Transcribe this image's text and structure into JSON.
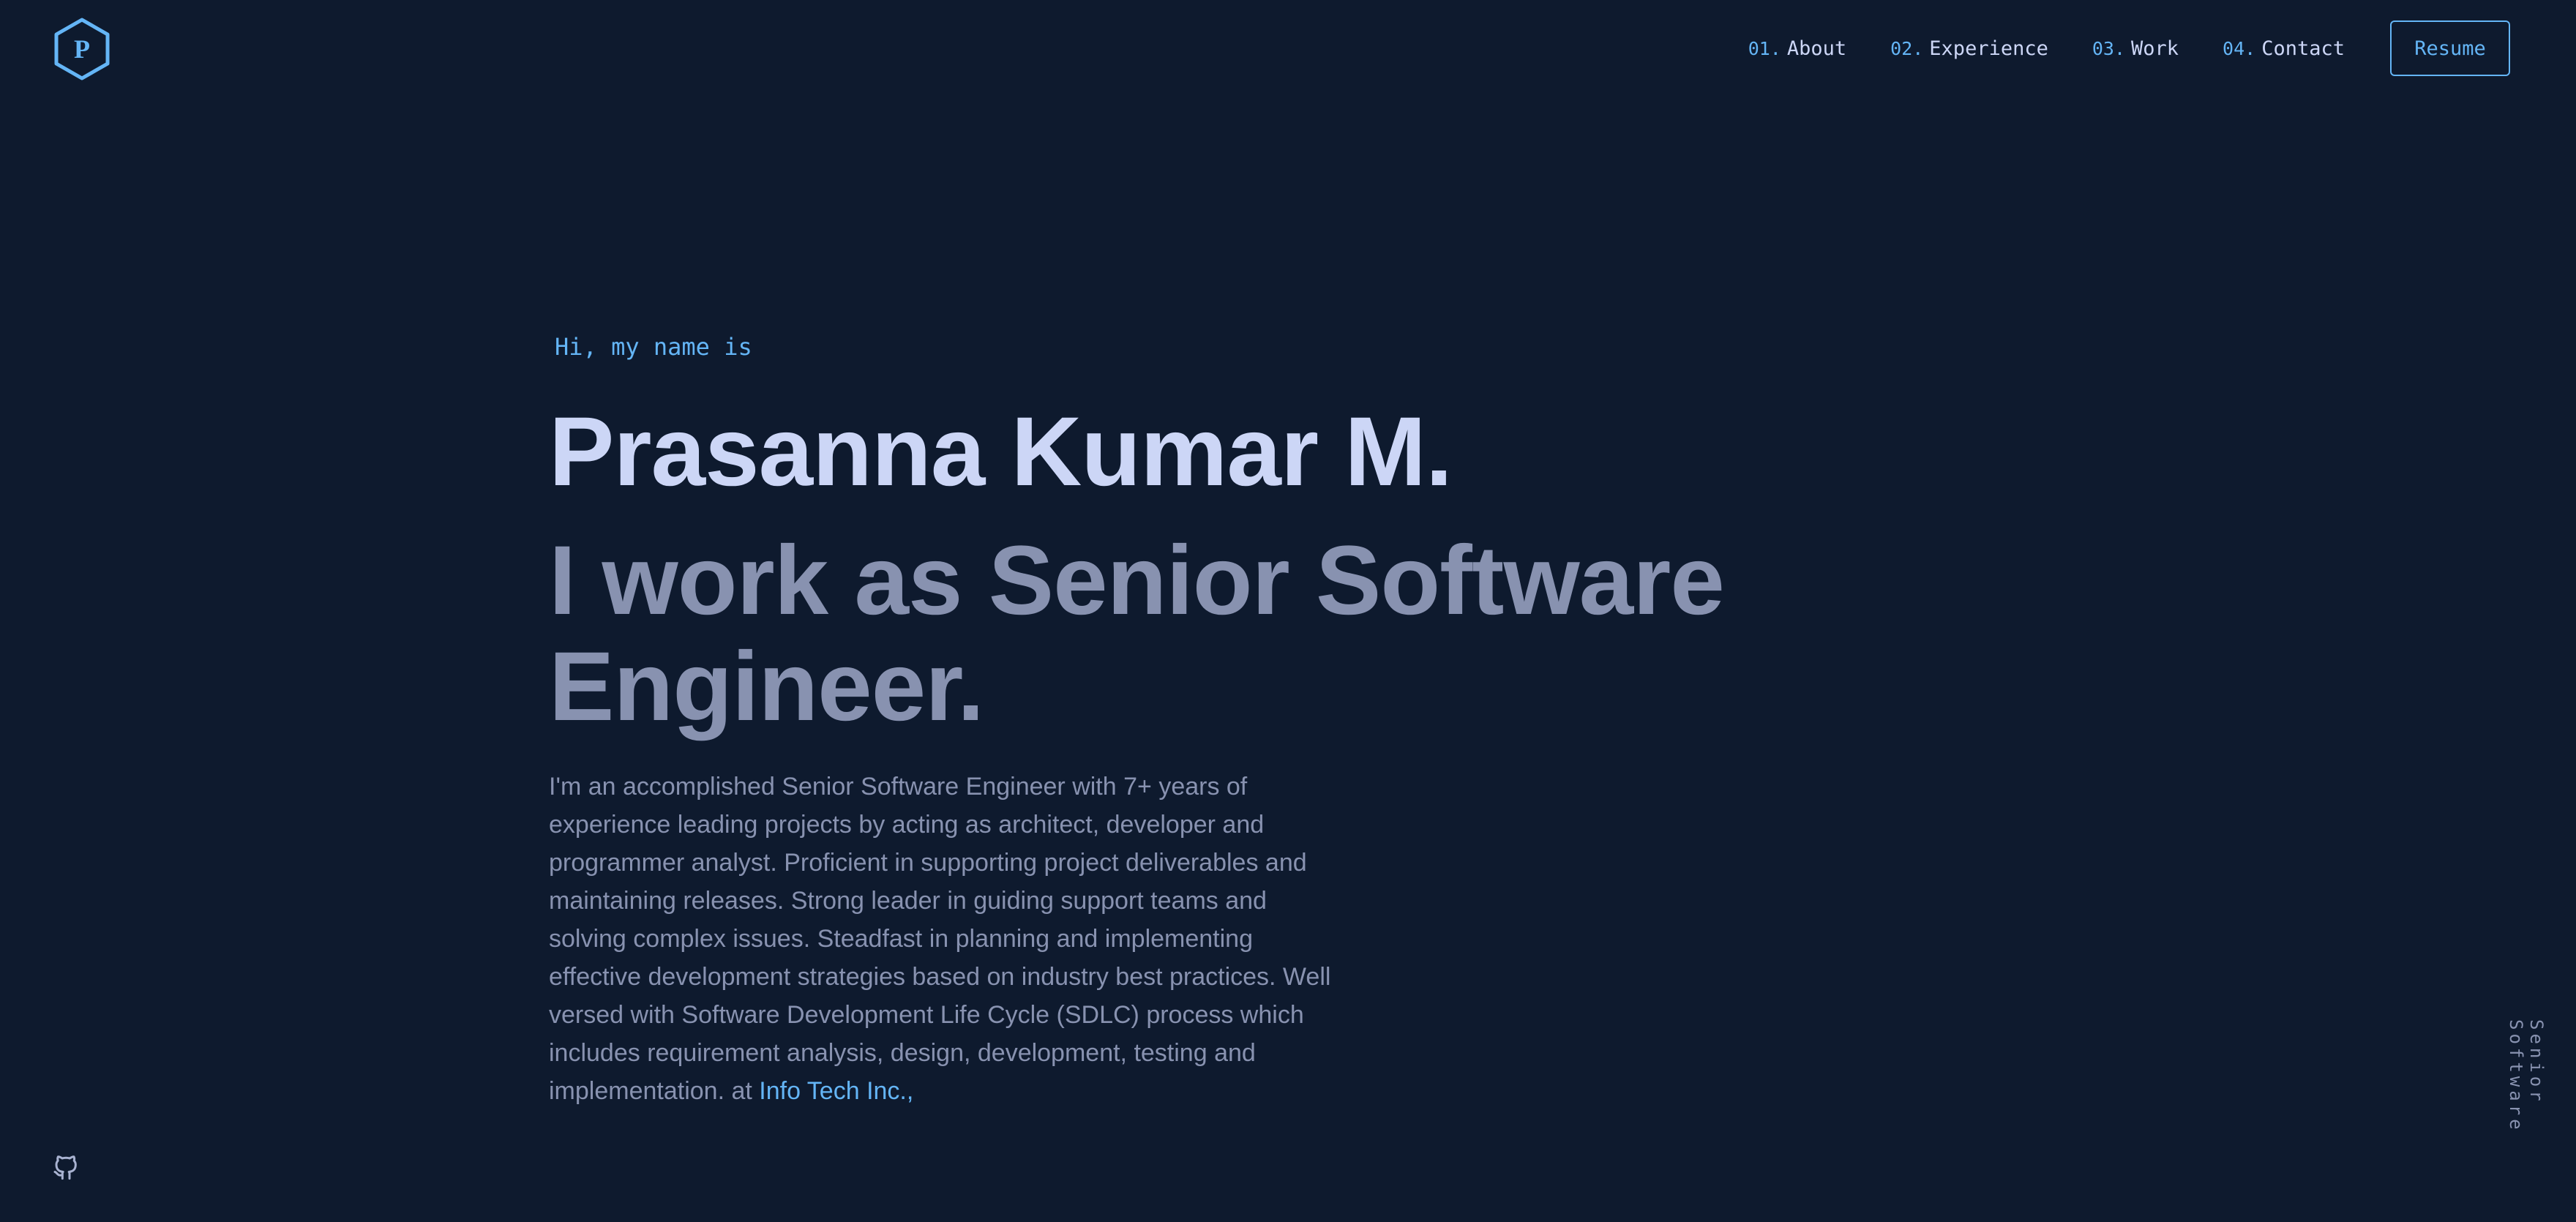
{
  "logo": {
    "letter": "P",
    "color": "#64b5f6"
  },
  "nav": {
    "items": [
      {
        "num": "01.",
        "label": "About"
      },
      {
        "num": "02.",
        "label": "Experience"
      },
      {
        "num": "03.",
        "label": "Work"
      },
      {
        "num": "04.",
        "label": "Contact"
      }
    ],
    "resume_label": "Resume"
  },
  "hero": {
    "greeting": "Hi, my name is",
    "name": "Prasanna Kumar M.",
    "tagline": "I work as Senior Software Engineer.",
    "bio": "I'm an accomplished Senior Software Engineer with 7+ years of experience leading projects by acting as architect, developer and programmer analyst. Proficient in supporting project deliverables and maintaining releases. Strong leader in guiding support teams and solving complex issues. Steadfast in planning and implementing effective development strategies based on industry best practices. Well versed with Software Development Life Cycle (SDLC) process which includes requirement analysis, design, development, testing and implementation. at ",
    "company": "Info Tech Inc.,"
  },
  "sidebar": {
    "vertical_text": "Senior Software"
  },
  "icons": {
    "github": "github-icon",
    "logo": "hexagon-logo-icon"
  },
  "colors": {
    "background": "#0e1a2e",
    "accent": "#64b5f6",
    "heading": "#ccd6f6",
    "muted": "#8892b0"
  }
}
